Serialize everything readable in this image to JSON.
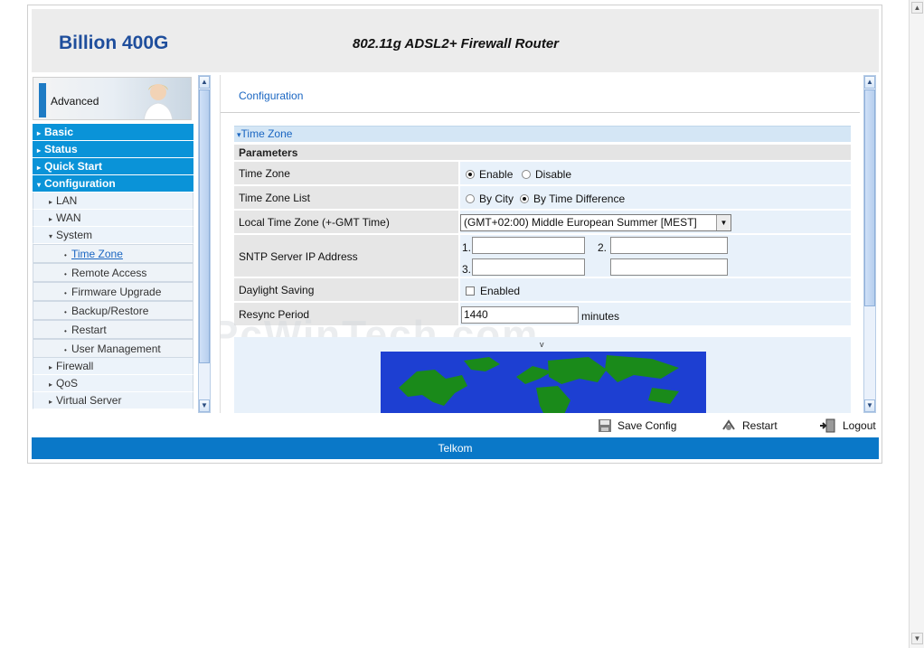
{
  "header": {
    "brand": "Billion 400G",
    "tagline": "802.11g ADSL2+ Firewall Router"
  },
  "sidebar": {
    "banner_label": "Advanced",
    "items": [
      {
        "label": "Basic",
        "level": "top"
      },
      {
        "label": "Status",
        "level": "top"
      },
      {
        "label": "Quick Start",
        "level": "top"
      },
      {
        "label": "Configuration",
        "level": "top",
        "expanded": true
      },
      {
        "label": "LAN",
        "level": "sub"
      },
      {
        "label": "WAN",
        "level": "sub"
      },
      {
        "label": "System",
        "level": "sub",
        "expanded": true
      },
      {
        "label": "Time Zone",
        "level": "subsub",
        "active": true
      },
      {
        "label": "Remote Access",
        "level": "subsub"
      },
      {
        "label": "Firmware Upgrade",
        "level": "subsub"
      },
      {
        "label": "Backup/Restore",
        "level": "subsub"
      },
      {
        "label": "Restart",
        "level": "subsub"
      },
      {
        "label": "User Management",
        "level": "subsub"
      },
      {
        "label": "Firewall",
        "level": "sub"
      },
      {
        "label": "QoS",
        "level": "sub"
      },
      {
        "label": "Virtual Server",
        "level": "sub"
      }
    ]
  },
  "content": {
    "breadcrumb": "Configuration",
    "section_title": "Time Zone",
    "params_header": "Parameters",
    "time_zone": {
      "label": "Time Zone",
      "options": [
        "Enable",
        "Disable"
      ],
      "selected": "Enable"
    },
    "time_zone_list": {
      "label": "Time Zone List",
      "options": [
        "By City",
        "By Time Difference"
      ],
      "selected": "By Time Difference"
    },
    "local_time_zone": {
      "label": "Local Time Zone (+-GMT Time)",
      "value": "(GMT+02:00) Middle European Summer [MEST]"
    },
    "sntp": {
      "label": "SNTP Server IP Address",
      "n1": "1.",
      "n2": "2.",
      "n3": "3."
    },
    "daylight_saving": {
      "label": "Daylight Saving",
      "option": "Enabled",
      "checked": false
    },
    "resync_period": {
      "label": "Resync Period",
      "value": "1440",
      "unit": "minutes"
    },
    "map_caret": "v",
    "watermark": "PcWinTech.com"
  },
  "actions": {
    "save_config": "Save Config",
    "restart": "Restart",
    "logout": "Logout"
  },
  "footer": {
    "label": "Telkom"
  },
  "colors": {
    "accent": "#0a93d8",
    "footer": "#0a78c8",
    "brand": "#1f4e9c",
    "link": "#1a66c2"
  }
}
